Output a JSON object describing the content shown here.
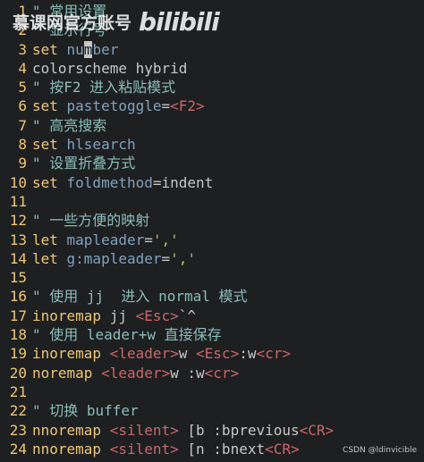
{
  "lines": [
    {
      "n": "1",
      "parts": [
        {
          "t": "\" 常用设置",
          "c": "cm"
        }
      ]
    },
    {
      "n": "2",
      "parts": [
        {
          "t": "\" 显示行号",
          "c": "cm"
        }
      ]
    },
    {
      "n": "3",
      "parts": [
        {
          "t": "set ",
          "c": "kw"
        },
        {
          "t": "nu",
          "c": "opt"
        },
        {
          "t": "m",
          "c": "cursor"
        },
        {
          "t": "ber",
          "c": "opt"
        }
      ]
    },
    {
      "n": "4",
      "parts": [
        {
          "t": "colorscheme hybrid",
          "c": ""
        }
      ]
    },
    {
      "n": "5",
      "parts": [
        {
          "t": "\" 按F2 进入粘贴模式",
          "c": "cm"
        }
      ]
    },
    {
      "n": "6",
      "parts": [
        {
          "t": "set ",
          "c": "kw"
        },
        {
          "t": "pastetoggle",
          "c": "opt"
        },
        {
          "t": "=",
          "c": ""
        },
        {
          "t": "<F2>",
          "c": "sp"
        }
      ]
    },
    {
      "n": "7",
      "parts": [
        {
          "t": "\" 高亮搜索",
          "c": "cm"
        }
      ]
    },
    {
      "n": "8",
      "parts": [
        {
          "t": "set ",
          "c": "kw"
        },
        {
          "t": "hlsearch",
          "c": "opt"
        }
      ]
    },
    {
      "n": "9",
      "parts": [
        {
          "t": "\" 设置折叠方式",
          "c": "cm"
        }
      ]
    },
    {
      "n": "10",
      "parts": [
        {
          "t": "set ",
          "c": "kw"
        },
        {
          "t": "foldmethod",
          "c": "opt"
        },
        {
          "t": "=indent",
          "c": ""
        }
      ]
    },
    {
      "n": "11",
      "parts": []
    },
    {
      "n": "12",
      "parts": [
        {
          "t": "\" 一些方便的映射",
          "c": "cm"
        }
      ]
    },
    {
      "n": "13",
      "parts": [
        {
          "t": "let ",
          "c": "kw"
        },
        {
          "t": "mapleader",
          "c": "opt"
        },
        {
          "t": "=",
          "c": ""
        },
        {
          "t": "','",
          "c": "str"
        }
      ]
    },
    {
      "n": "14",
      "parts": [
        {
          "t": "let ",
          "c": "kw"
        },
        {
          "t": "g:mapleader",
          "c": "opt"
        },
        {
          "t": "=",
          "c": ""
        },
        {
          "t": "','",
          "c": "str"
        }
      ]
    },
    {
      "n": "15",
      "parts": []
    },
    {
      "n": "16",
      "parts": [
        {
          "t": "\" 使用 jj  进入 normal 模式",
          "c": "cm"
        }
      ]
    },
    {
      "n": "17",
      "parts": [
        {
          "t": "inoremap ",
          "c": "kw"
        },
        {
          "t": "jj ",
          "c": ""
        },
        {
          "t": "<Esc>",
          "c": "sp"
        },
        {
          "t": "`^",
          "c": ""
        }
      ]
    },
    {
      "n": "18",
      "parts": [
        {
          "t": "\" 使用 leader+w 直接保存",
          "c": "cm"
        }
      ]
    },
    {
      "n": "19",
      "parts": [
        {
          "t": "inoremap ",
          "c": "kw"
        },
        {
          "t": "<leader>",
          "c": "sp"
        },
        {
          "t": "w ",
          "c": ""
        },
        {
          "t": "<Esc>",
          "c": "sp"
        },
        {
          "t": ":w",
          "c": ""
        },
        {
          "t": "<cr>",
          "c": "sp"
        }
      ]
    },
    {
      "n": "20",
      "parts": [
        {
          "t": "noremap ",
          "c": "kw"
        },
        {
          "t": "<leader>",
          "c": "sp"
        },
        {
          "t": "w :w",
          "c": ""
        },
        {
          "t": "<cr>",
          "c": "sp"
        }
      ]
    },
    {
      "n": "21",
      "parts": []
    },
    {
      "n": "22",
      "parts": [
        {
          "t": "\" 切换 buffer",
          "c": "cm"
        }
      ]
    },
    {
      "n": "23",
      "parts": [
        {
          "t": "nnoremap ",
          "c": "kw"
        },
        {
          "t": "<silent>",
          "c": "sp"
        },
        {
          "t": " [b :bprevious",
          "c": ""
        },
        {
          "t": "<CR>",
          "c": "sp"
        }
      ]
    },
    {
      "n": "24",
      "parts": [
        {
          "t": "nnoremap ",
          "c": "kw"
        },
        {
          "t": "<silent>",
          "c": "sp"
        },
        {
          "t": " [n :bnext",
          "c": ""
        },
        {
          "t": "<CR>",
          "c": "sp"
        }
      ]
    }
  ],
  "watermark": {
    "text": "慕课网官方账号",
    "logo": "bilibili"
  },
  "credit": "CSDN @ldinvicible",
  "colors": {
    "background": "#1d1f21",
    "foreground": "#c5c8c6",
    "keyword": "#f0c674",
    "option": "#81a2be",
    "string": "#b5bd68",
    "comment": "#8abeb7",
    "special": "#cc6666"
  }
}
